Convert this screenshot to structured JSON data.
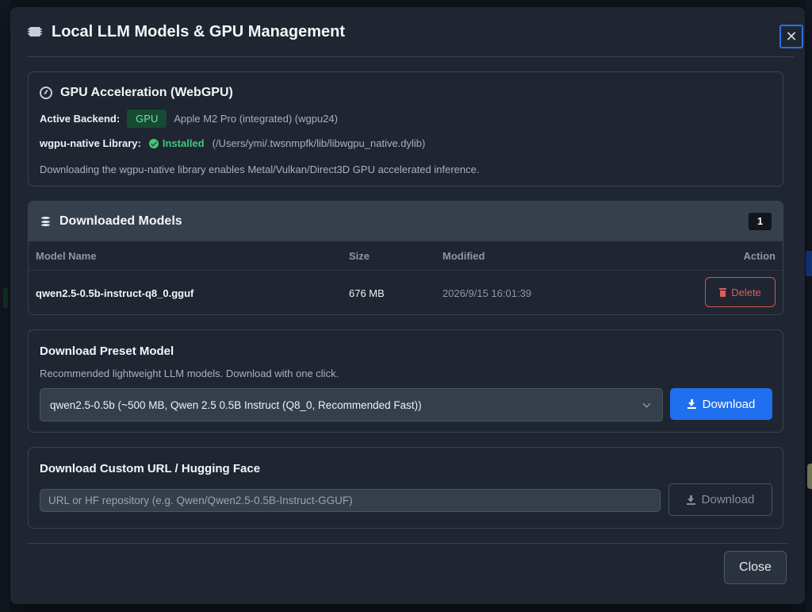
{
  "modal": {
    "title": "Local LLM Models & GPU Management",
    "close_symbol": "✕"
  },
  "gpu": {
    "title": "GPU Acceleration (WebGPU)",
    "backend_label": "Active Backend:",
    "backend_badge": "GPU",
    "backend_device": "Apple M2 Pro (integrated) (wgpu24)",
    "library_label": "wgpu-native Library:",
    "library_status": "Installed",
    "library_path": "(/Users/ymi/.twsnmpfk/lib/libwgpu_native.dylib)",
    "description": "Downloading the wgpu-native library enables Metal/Vulkan/Direct3D GPU accelerated inference.",
    "status_color": "#43c57c"
  },
  "models": {
    "title": "Downloaded Models",
    "count": "1",
    "columns": {
      "name": "Model Name",
      "size": "Size",
      "modified": "Modified",
      "action": "Action"
    },
    "rows": [
      {
        "name": "qwen2.5-0.5b-instruct-q8_0.gguf",
        "size": "676 MB",
        "modified": "2026/9/15 16:01:39",
        "action_label": "Delete"
      }
    ]
  },
  "preset": {
    "title": "Download Preset Model",
    "description": "Recommended lightweight LLM models. Download with one click.",
    "selected_option": "qwen2.5-0.5b (~500 MB, Qwen 2.5 0.5B Instruct (Q8_0, Recommended Fast))",
    "download_label": "Download",
    "accent_color": "#1f6fee"
  },
  "custom": {
    "title": "Download Custom URL / Hugging Face",
    "placeholder": "URL or HF repository (e.g. Qwen/Qwen2.5-0.5B-Instruct-GGUF)",
    "download_label": "Download"
  },
  "footer": {
    "close_label": "Close"
  }
}
